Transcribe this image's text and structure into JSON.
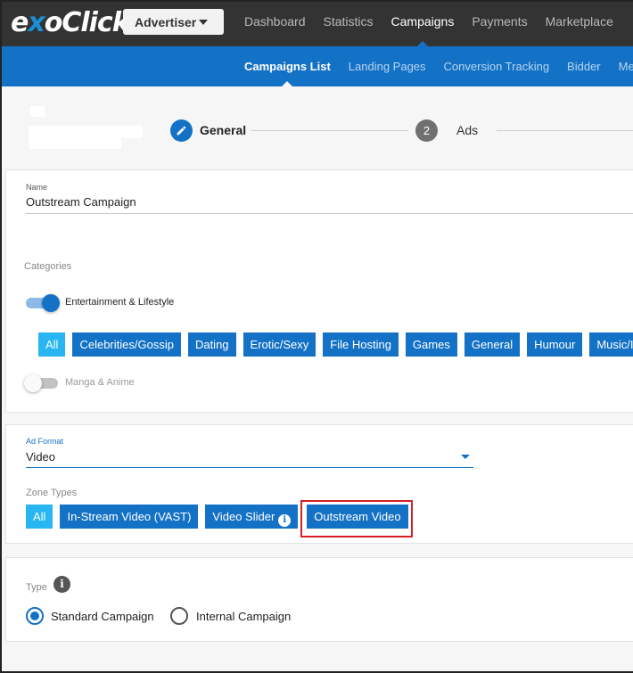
{
  "brand": {
    "logo_pre": "e",
    "logo_x": "x",
    "logo_post": "oClick"
  },
  "account_select": {
    "value": "Advertiser"
  },
  "top_nav": [
    "Dashboard",
    "Statistics",
    "Campaigns",
    "Payments",
    "Marketplace"
  ],
  "top_nav_active": "Campaigns",
  "sub_nav": [
    "Campaigns List",
    "Landing Pages",
    "Conversion Tracking",
    "Bidder",
    "Me"
  ],
  "sub_nav_active": "Campaigns List",
  "stepper": {
    "step1": {
      "label": "General",
      "icon": "pencil-icon"
    },
    "step2": {
      "number": "2",
      "label": "Ads"
    }
  },
  "general": {
    "name_label": "Name",
    "name_value": "Outstream Campaign",
    "categories_label": "Categories",
    "category_entertainment": {
      "label": "Entertainment & Lifestyle",
      "enabled": true
    },
    "subcategories": [
      "All",
      "Celebrities/Gossip",
      "Dating",
      "Erotic/Sexy",
      "File Hosting",
      "Games",
      "General",
      "Humour",
      "Music/I"
    ],
    "category_manga": {
      "label": "Manga & Anime",
      "enabled": false
    }
  },
  "ad_format": {
    "label": "Ad Format",
    "value": "Video",
    "zone_types_label": "Zone Types",
    "zone_types": [
      "All",
      "In-Stream Video (VAST)",
      "Video Slider",
      "Outstream Video"
    ],
    "info_glyph": "i",
    "highlighted": "Outstream Video"
  },
  "type": {
    "label": "Type",
    "info_glyph": "i",
    "options": [
      {
        "label": "Standard Campaign",
        "checked": true
      },
      {
        "label": "Internal Campaign",
        "checked": false
      }
    ]
  },
  "colors": {
    "primary": "#1472c6",
    "topbar": "#333333",
    "chip_all": "#27b6f2",
    "highlight": "#d4202a"
  }
}
